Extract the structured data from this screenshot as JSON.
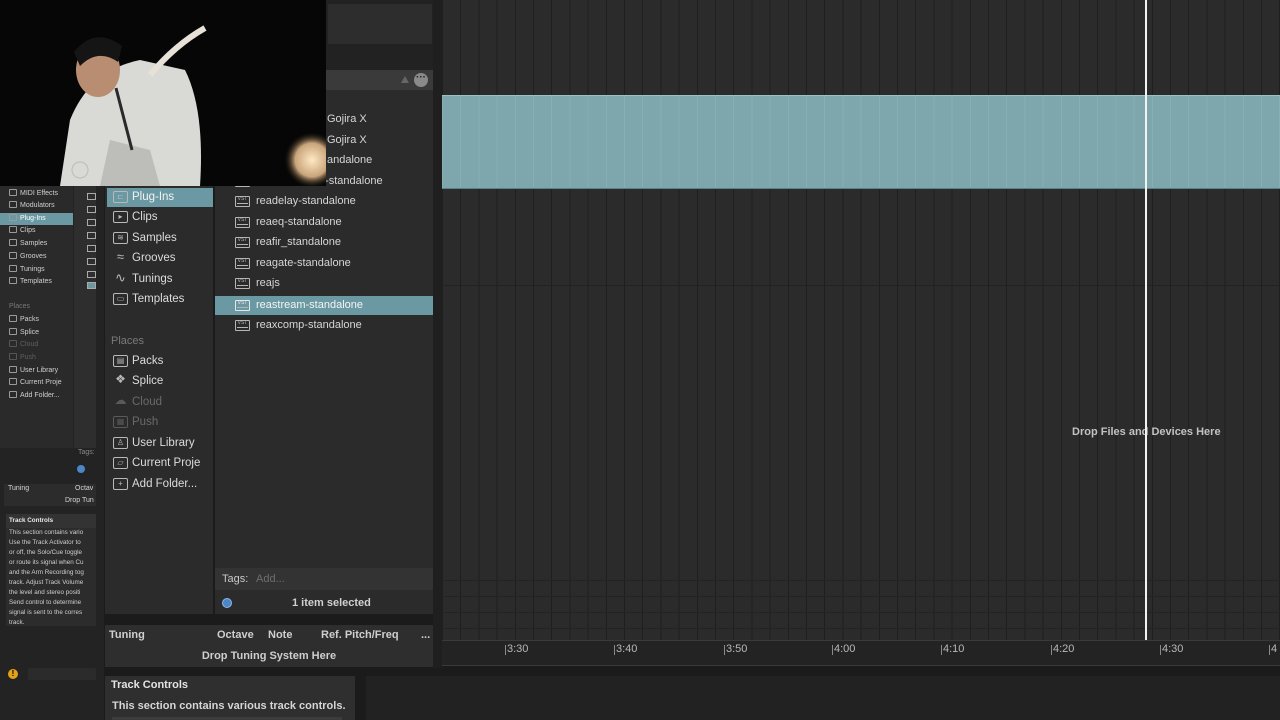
{
  "mini_browser": {
    "categories": [
      {
        "label": "MIDI Effects",
        "selected": false
      },
      {
        "label": "Modulators",
        "selected": false
      },
      {
        "label": "Plug-Ins",
        "selected": true
      },
      {
        "label": "Clips",
        "selected": false
      },
      {
        "label": "Samples",
        "selected": false
      },
      {
        "label": "Grooves",
        "selected": false
      },
      {
        "label": "Tunings",
        "selected": false
      },
      {
        "label": "Templates",
        "selected": false
      }
    ],
    "places_heading": "Places",
    "places": [
      {
        "label": "Packs",
        "disabled": false
      },
      {
        "label": "Splice",
        "disabled": false
      },
      {
        "label": "Cloud",
        "disabled": true
      },
      {
        "label": "Push",
        "disabled": true
      },
      {
        "label": "User Library",
        "disabled": false
      },
      {
        "label": "Current Proje",
        "disabled": false
      },
      {
        "label": "Add Folder...",
        "disabled": false
      }
    ],
    "tags_label": "Tags:",
    "tuning_label": "Tuning",
    "octave_label": "Octav",
    "drop_tuning": "Drop Tun",
    "track_controls_title": "Track Controls",
    "track_controls_text": [
      "This section contains vario",
      "Use the Track Activator to",
      "or off, the Solo/Cue toggle",
      "or route its signal when Cu",
      "and the Arm Recording tog",
      "track. Adjust Track Volume",
      "the level and stereo positi",
      "Send control to determine",
      "signal is sent to the corres",
      "track."
    ]
  },
  "browser": {
    "categories": [
      {
        "label": "Plug-Ins",
        "icon": "plug-ins-icon",
        "selected": true
      },
      {
        "label": "Clips",
        "icon": "clips-icon",
        "selected": false
      },
      {
        "label": "Samples",
        "icon": "samples-icon",
        "selected": false
      },
      {
        "label": "Grooves",
        "icon": "grooves-icon",
        "selected": false
      },
      {
        "label": "Tunings",
        "icon": "tunings-icon",
        "selected": false
      },
      {
        "label": "Templates",
        "icon": "templates-icon",
        "selected": false
      }
    ],
    "places_heading": "Places",
    "places": [
      {
        "label": "Packs",
        "icon": "packs-icon",
        "disabled": false
      },
      {
        "label": "Splice",
        "icon": "splice-icon",
        "disabled": false
      },
      {
        "label": "Cloud",
        "icon": "cloud-icon",
        "disabled": true
      },
      {
        "label": "Push",
        "icon": "push-icon",
        "disabled": true
      },
      {
        "label": "User Library",
        "icon": "user-library-icon",
        "disabled": false
      },
      {
        "label": "Current Proje",
        "icon": "current-project-icon",
        "disabled": false
      },
      {
        "label": "Add Folder...",
        "icon": "add-folder-icon",
        "disabled": false
      }
    ],
    "files": [
      {
        "label": "Gojira X",
        "selected": false
      },
      {
        "label": "Gojira X",
        "selected": false
      },
      {
        "label": "andalone",
        "selected": false
      },
      {
        "label": "reacontrolmidi-standalone",
        "selected": false
      },
      {
        "label": "readelay-standalone",
        "selected": false
      },
      {
        "label": "reaeq-standalone",
        "selected": false
      },
      {
        "label": "reafir_standalone",
        "selected": false
      },
      {
        "label": "reagate-standalone",
        "selected": false
      },
      {
        "label": "reajs",
        "selected": false
      },
      {
        "label": "reastream-standalone",
        "selected": true
      },
      {
        "label": "reaxcomp-standalone",
        "selected": false
      }
    ],
    "file_icon_text": "VST",
    "tags_label": "Tags:",
    "tags_placeholder": "Add...",
    "status": "1 item selected"
  },
  "tuning": {
    "columns": [
      "Tuning",
      "Octave",
      "Note",
      "Ref. Pitch/Freq"
    ],
    "more": "...",
    "drop_text": "Drop Tuning System Here"
  },
  "track_controls": {
    "title": "Track Controls",
    "description": "This section contains various track controls."
  },
  "arrangement": {
    "drop_text": "Drop Files and Devices Here",
    "ruler": [
      "3:30",
      "3:40",
      "3:50",
      "4:00",
      "4:10",
      "4:20",
      "4:30",
      "4"
    ],
    "clip_color": "#7ea6ad",
    "selection_color": "#6b99a3"
  }
}
